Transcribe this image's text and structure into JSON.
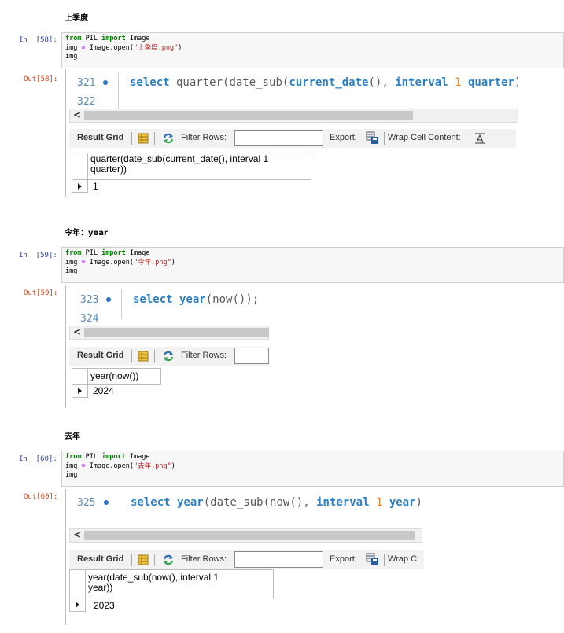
{
  "sections": [
    {
      "heading": "上季度",
      "in_prompt": "In  [58]:",
      "out_prompt": "Out[58]:",
      "code": {
        "l1_kw1": "from",
        "l1_mod": " PIL ",
        "l1_kw2": "import",
        "l1_name": " Image",
        "l2_pre": "img ",
        "l2_op": "=",
        "l2_call": " Image.open(",
        "l2_str": "\"上季度.png\"",
        "l2_close": ")",
        "l3": "img"
      },
      "editor": {
        "line1": "321",
        "line2": "322",
        "sql_kw1": "select",
        "sql_p1": " quarter(",
        "sql_f1": "date_sub",
        "sql_p2": "(",
        "sql_f2": "current_date",
        "sql_p3": "(), ",
        "sql_kw2": "interval",
        "sql_sp": " ",
        "sql_num": "1",
        "sql_sp2": " ",
        "sql_kw3": "quarter",
        "sql_end": "));"
      },
      "toolbar": {
        "result_grid": "Result Grid",
        "filter_rows": "Filter Rows:",
        "export": "Export:",
        "wrap": "Wrap Cell Content:"
      },
      "grid": {
        "column_line1": "quarter(date_sub(current_date(), interval 1",
        "column_line2": "quarter))",
        "value": "1"
      }
    },
    {
      "heading": "今年：year",
      "in_prompt": "In  [59]:",
      "out_prompt": "Out[59]:",
      "code": {
        "l1_kw1": "from",
        "l1_mod": " PIL ",
        "l1_kw2": "import",
        "l1_name": " Image",
        "l2_pre": "img ",
        "l2_op": "=",
        "l2_call": " Image.open(",
        "l2_str": "\"今年.png\"",
        "l2_close": ")",
        "l3": "img"
      },
      "editor": {
        "line1": "323",
        "line2": "324",
        "sql_kw1": "select",
        "sql_p1": " ",
        "sql_kw2": "year",
        "sql_p2": "(",
        "sql_f1": "now",
        "sql_end": "());"
      },
      "toolbar": {
        "result_grid": "Result Grid",
        "filter_rows": "Filter Rows:"
      },
      "grid": {
        "column_line1": "year(now())",
        "value": "2024"
      }
    },
    {
      "heading": "去年",
      "in_prompt": "In  [60]:",
      "out_prompt": "Out[60]:",
      "code": {
        "l1_kw1": "from",
        "l1_mod": " PIL ",
        "l1_kw2": "import",
        "l1_name": " Image",
        "l2_pre": "img ",
        "l2_op": "=",
        "l2_call": " Image.open(",
        "l2_str": "\"去年.png\"",
        "l2_close": ")",
        "l3": "img"
      },
      "editor": {
        "line1": "325",
        "sql_kw1": "select",
        "sql_p1": " ",
        "sql_kw2": "year",
        "sql_p2": "(",
        "sql_f1": "date_sub",
        "sql_p3": "(",
        "sql_f2": "now",
        "sql_p4": "(), ",
        "sql_kw3": "interval",
        "sql_sp": " ",
        "sql_num": "1",
        "sql_sp2": " ",
        "sql_kw4": "year",
        "sql_end": "));"
      },
      "toolbar": {
        "result_grid": "Result Grid",
        "filter_rows": "Filter Rows:",
        "export": "Export:",
        "wrap": "Wrap C"
      },
      "grid": {
        "column_line1": "year(date_sub(now(), interval 1",
        "column_line2": "year))",
        "value": "2023"
      }
    }
  ]
}
